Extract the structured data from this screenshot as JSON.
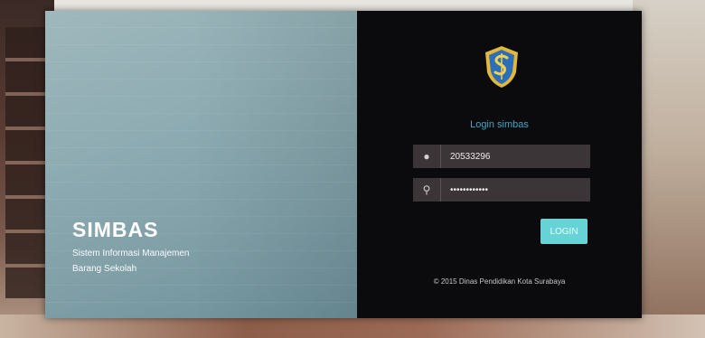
{
  "hero": {
    "title": "SIMBAS",
    "subtitle": "Sistem Informasi Manajemen Barang Sekolah"
  },
  "login": {
    "logo": "surabaya-crest-icon",
    "title": "Login simbas",
    "username": {
      "icon": "user-icon",
      "value": "20533296"
    },
    "password": {
      "icon": "key-icon",
      "value": "••••••••••••"
    },
    "button_label": "LOGIN",
    "footer": "© 2015 Dinas Pendidikan Kota Surabaya"
  },
  "colors": {
    "accent": "#3ea6c6",
    "button": "#66d3d7",
    "panel": "#0b0b0d",
    "hero": "#8fadb3"
  }
}
